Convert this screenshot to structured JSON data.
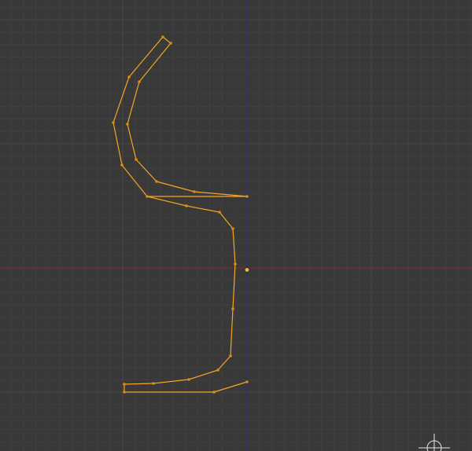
{
  "viewport": {
    "mode": "edit",
    "selected_mesh": "profile-outline"
  },
  "colors": {
    "background": "#393939",
    "grid_minor": "#404040",
    "grid_major": "#464646",
    "axis_x": "#8a2a2a",
    "axis_y": "#2a2a8a",
    "edge": "#f5a623",
    "vertex": "#e08a10",
    "origin": "#f0b050",
    "gizmo": "#e6e6e6"
  },
  "icons": {
    "origin": "origin-icon",
    "gizmo": "navigation-gizmo-icon"
  }
}
